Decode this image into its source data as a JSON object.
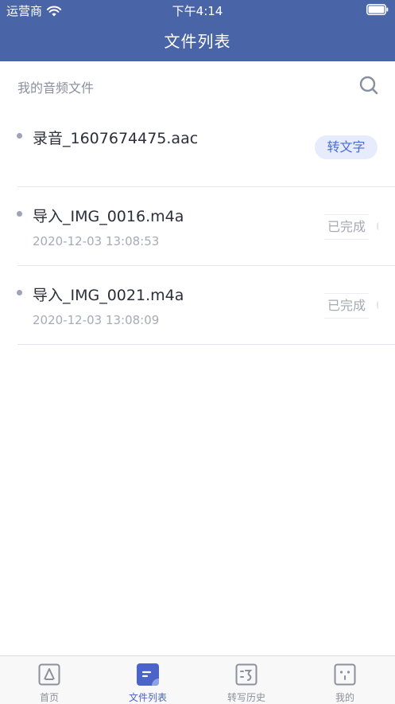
{
  "status_bar": {
    "carrier": "运营商",
    "time": "下午4:14"
  },
  "nav": {
    "title": "文件列表"
  },
  "section": {
    "title": "我的音频文件"
  },
  "files": [
    {
      "name": "录音_1607674475.aac",
      "date": "",
      "action": "转文字"
    },
    {
      "name": "导入_IMG_0016.m4a",
      "date": "2020-12-03 13:08:53",
      "status": "已完成"
    },
    {
      "name": "导入_IMG_0021.m4a",
      "date": "2020-12-03 13:08:09",
      "status": "已完成"
    }
  ],
  "tabs": [
    {
      "label": "首页",
      "icon": "home-icon",
      "active": false
    },
    {
      "label": "文件列表",
      "icon": "file-list-icon",
      "active": true
    },
    {
      "label": "转写历史",
      "icon": "history-icon",
      "active": false
    },
    {
      "label": "我的",
      "icon": "profile-icon",
      "active": false
    }
  ],
  "colors": {
    "primary": "#4a64a8",
    "accent": "#4a6cd8",
    "tab_active": "#4a64c8",
    "tab_inactive": "#8d909a"
  }
}
